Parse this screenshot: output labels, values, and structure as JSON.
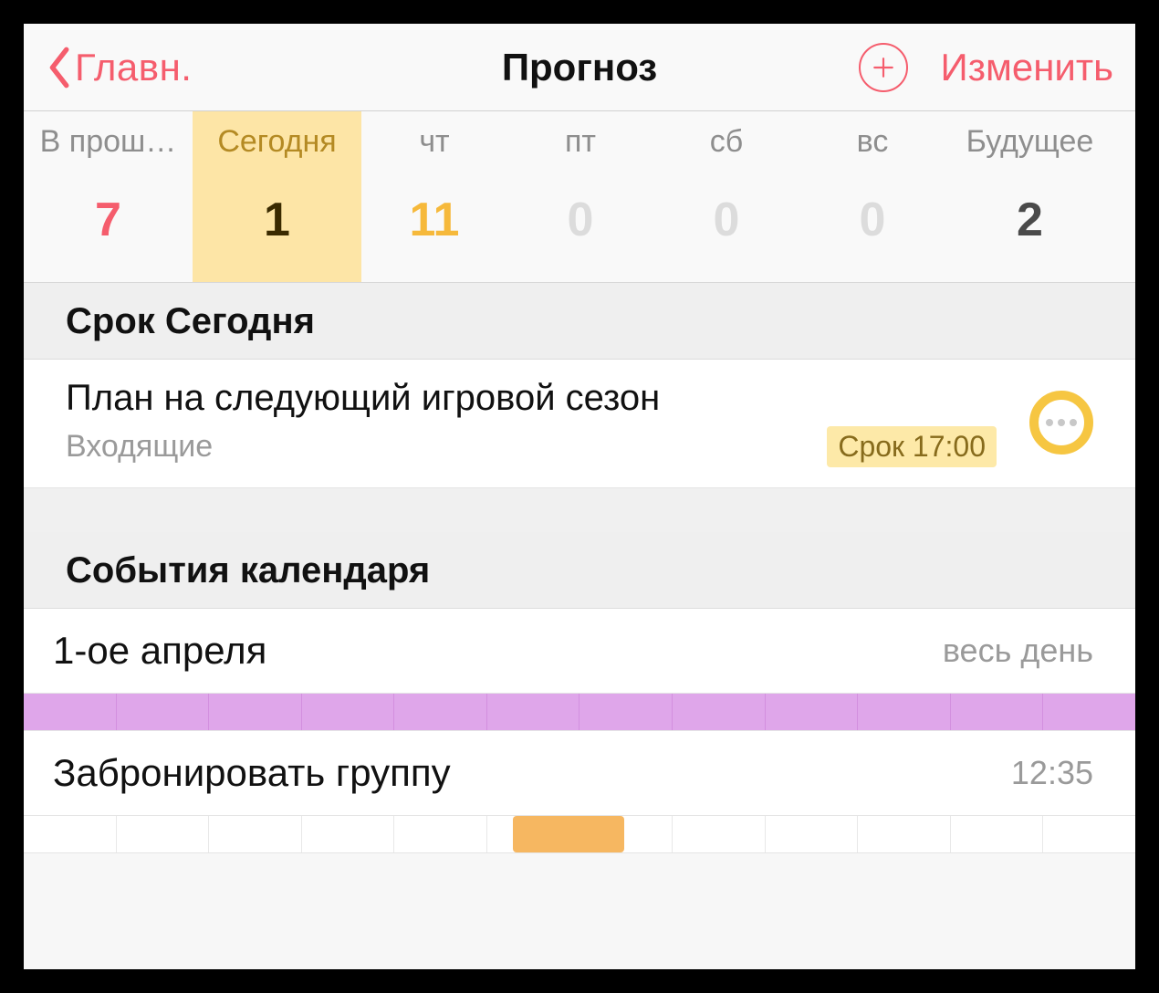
{
  "nav": {
    "back_label": "Главн.",
    "title": "Прогноз",
    "edit_label": "Изменить"
  },
  "days": [
    {
      "label": "В прош…",
      "count": "7",
      "kind": "past"
    },
    {
      "label": "Сегодня",
      "count": "1",
      "kind": "selected"
    },
    {
      "label": "чт",
      "count": "11",
      "kind": "soon"
    },
    {
      "label": "пт",
      "count": "0",
      "kind": "empty"
    },
    {
      "label": "сб",
      "count": "0",
      "kind": "empty"
    },
    {
      "label": "вс",
      "count": "0",
      "kind": "empty"
    },
    {
      "label": "Будущее",
      "count": "2",
      "kind": "future"
    }
  ],
  "sections": {
    "due_today": "Срок Сегодня",
    "calendar_events": "События календаря"
  },
  "task": {
    "title": "План на следующий игровой сезон",
    "folder": "Входящие",
    "due_badge": "Срок 17:00"
  },
  "events": [
    {
      "title": "1-ое апреля",
      "time_label": "весь день",
      "bar": {
        "type": "allday"
      }
    },
    {
      "title": "Забронировать группу",
      "time_label": "12:35",
      "bar": {
        "type": "slot",
        "left_pct": 44,
        "width_pct": 10
      }
    }
  ]
}
